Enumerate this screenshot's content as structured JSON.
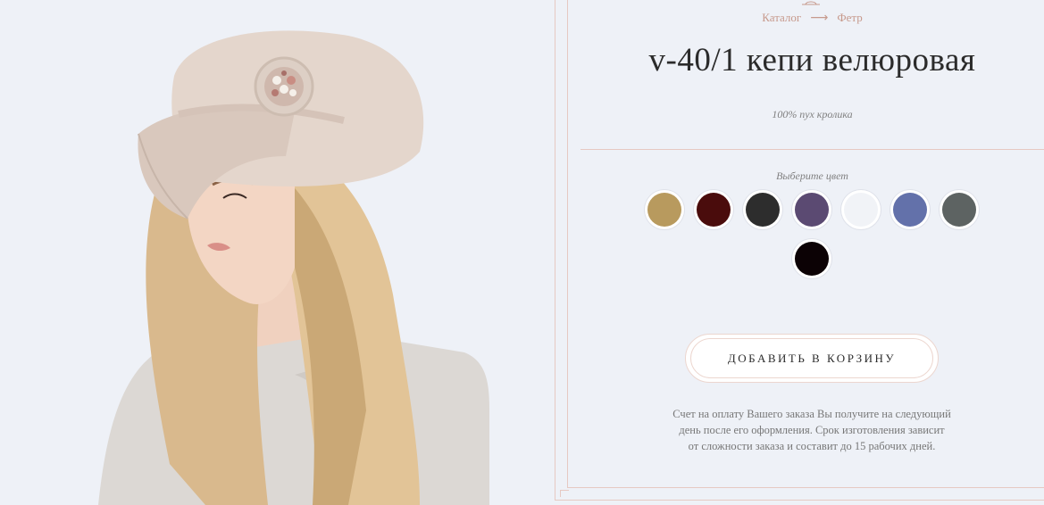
{
  "breadcrumb": {
    "items": [
      "Каталог",
      "Фетр"
    ],
    "separator": "⟶"
  },
  "product": {
    "title": "v-40/1 кепи велюровая",
    "material": "100% пух кролика"
  },
  "colors": {
    "label": "Выберите цвет",
    "swatches": [
      {
        "name": "camel",
        "hex": "#b89a5e"
      },
      {
        "name": "burgundy",
        "hex": "#4a0c0c"
      },
      {
        "name": "graphite",
        "hex": "#2d2d2d"
      },
      {
        "name": "purple",
        "hex": "#5b4a72"
      },
      {
        "name": "white",
        "hex": "#f1f3f7"
      },
      {
        "name": "blue",
        "hex": "#6371aa"
      },
      {
        "name": "grey",
        "hex": "#5d6362"
      },
      {
        "name": "black",
        "hex": "#0c0205"
      }
    ]
  },
  "cart": {
    "button_label": "ДОБАВИТЬ В КОРЗИНУ"
  },
  "note": {
    "line1": "Счет на оплату Вашего заказа Вы получите на следующий",
    "line2": "день после его оформления. Срок изготовления зависит",
    "line3": "от сложности заказа и составит до 15 рабочих дней."
  },
  "theme": {
    "background": "#eef1f7",
    "accent": "#c79a8d",
    "frame": "#e6c9c2"
  },
  "icons": [
    "hat-ornament-icon",
    "arrow-right-icon"
  ]
}
